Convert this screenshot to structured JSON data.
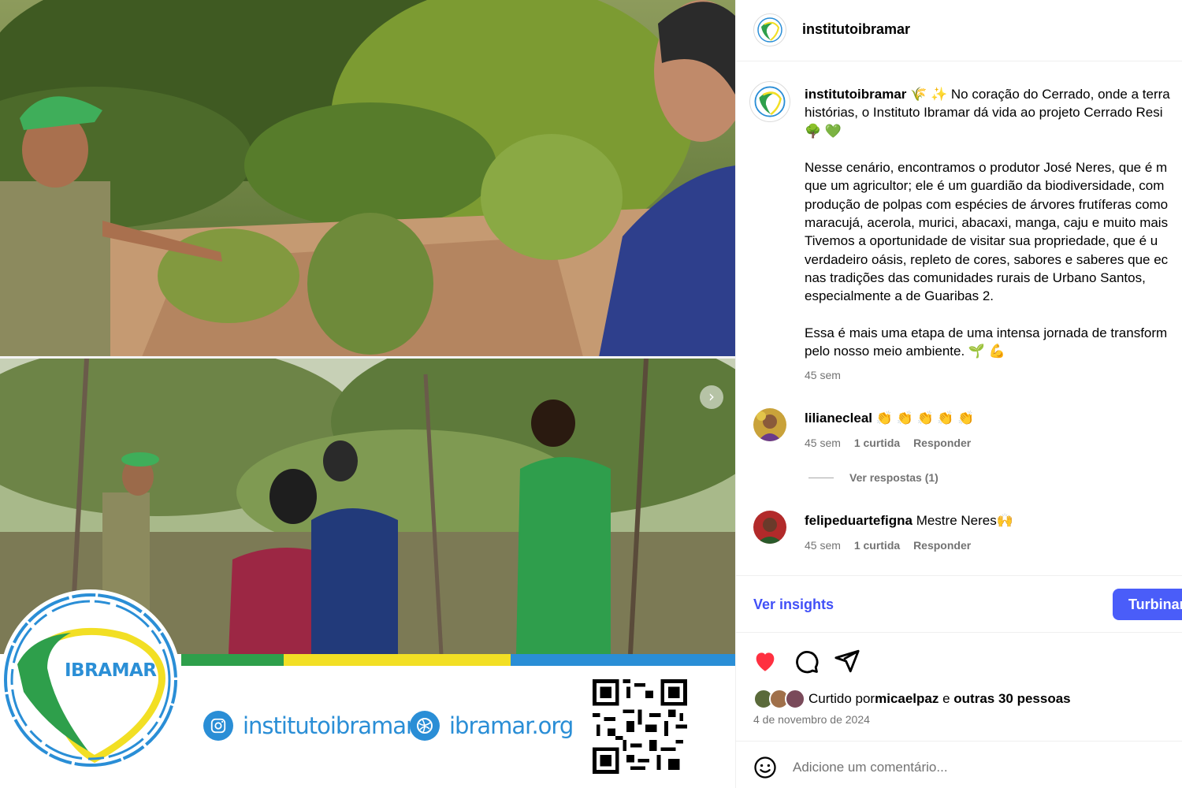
{
  "media": {
    "banner": {
      "logo_text": "IBRAMAR",
      "instagram_handle": "institutoibramar",
      "website": "ibramar.org"
    }
  },
  "header": {
    "username": "institutoibramar"
  },
  "caption": {
    "username": "institutoibramar",
    "text": " 🌾 ✨ No coração do Cerrado, onde a terra\nhistórias, o Instituto Ibramar dá vida ao projeto Cerrado Resi\n🌳 💚\n\nNesse cenário, encontramos o produtor José Neres, que é m\nque um agricultor; ele é um guardião da biodiversidade, com\nprodução de polpas com espécies de árvores frutíferas como\nmaracujá, acerola, murici, abacaxi, manga, caju e muito mais\nTivemos a oportunidade de visitar sua propriedade, que é u\nverdadeiro oásis, repleto de cores, sabores e saberes que ec\nnas tradições das comunidades rurais de Urbano Santos,\nespecialmente a de Guaribas 2.\n\nEssa é mais uma etapa de uma intensa jornada de transform\npelo nosso meio ambiente. 🌱 💪",
    "time": "45 sem"
  },
  "comments": [
    {
      "username": "lilianecleal",
      "text": " 👏 👏 👏 👏 👏",
      "time": "45 sem",
      "likes": "1 curtida",
      "reply_label": "Responder"
    },
    {
      "username": "felipeduartefigna",
      "text": " Mestre Neres🙌",
      "time": "45 sem",
      "likes": "1 curtida",
      "reply_label": "Responder"
    }
  ],
  "view_replies": "Ver respostas (1)",
  "insights": {
    "link_label": "Ver insights",
    "boost_label": "Turbinar"
  },
  "actions": {
    "like_icon": "heart-filled-icon",
    "comment_icon": "speech-bubble-icon",
    "share_icon": "paper-plane-icon"
  },
  "likes": {
    "prefix": "Curtido por ",
    "user": "micaelpaz",
    "middle": " e ",
    "others": "outras 30 pessoas"
  },
  "post_date": "4 de novembro de 2024",
  "add_comment": {
    "placeholder": "Adicione um comentário..."
  },
  "colors": {
    "like_red": "#ff3040",
    "link_blue": "#4150f7",
    "boost_blue": "#4a5df9",
    "brand_green": "#2e9f4b",
    "brand_yellow": "#f2df24",
    "brand_blue": "#2a8ed6"
  }
}
